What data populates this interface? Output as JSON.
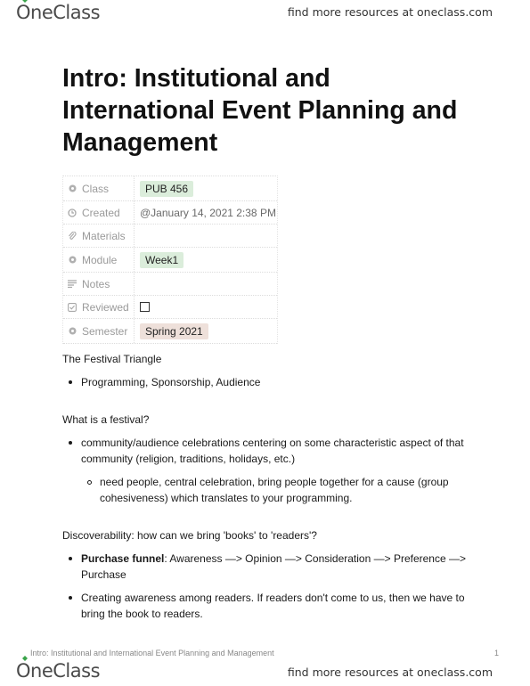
{
  "header": {
    "brand": "OneClass",
    "promo": "find more resources at oneclass.com"
  },
  "document": {
    "title": "Intro: Institutional and International Event Planning and Management",
    "properties": [
      {
        "key": "Class",
        "icon": "tag-icon",
        "value": "PUB 456",
        "type": "tag",
        "color": "#dbeddb"
      },
      {
        "key": "Created",
        "icon": "clock-icon",
        "value": "@January 14, 2021 2:38 PM",
        "type": "text"
      },
      {
        "key": "Materials",
        "icon": "paperclip-icon",
        "value": "",
        "type": "text"
      },
      {
        "key": "Module",
        "icon": "tag-icon",
        "value": "Week1",
        "type": "tag",
        "color": "#dbeddb"
      },
      {
        "key": "Notes",
        "icon": "text-lines-icon",
        "value": "",
        "type": "text"
      },
      {
        "key": "Reviewed",
        "icon": "checkbox-icon",
        "value": false,
        "type": "checkbox"
      },
      {
        "key": "Semester",
        "icon": "tag-icon",
        "value": "Spring 2021",
        "type": "tag",
        "color": "#eee0da"
      }
    ],
    "sections": {
      "festival_triangle": {
        "heading": "The Festival Triangle",
        "bullets": [
          "Programming, Sponsorship, Audience"
        ]
      },
      "what_is_festival": {
        "heading": "What is a festival?",
        "bullet": "community/audience celebrations centering on some characteristic aspect of that community (religion, traditions, holidays, etc.)",
        "sub_bullet": "need people, central celebration, bring people together for a cause (group cohesiveness) which translates to your programming."
      },
      "discoverability": {
        "heading": "Discoverability: how can we bring 'books' to 'readers'?",
        "funnel_label": "Purchase funnel",
        "funnel_text": ": Awareness —> Opinion —> Consideration —> Preference —> Purchase",
        "bullet2": "Creating awareness among readers. If readers don't come to us, then we have to bring the book to readers."
      }
    }
  },
  "footer": {
    "doc_title": "Intro: Institutional and International Event Planning and Management",
    "page_number": "1",
    "brand": "OneClass",
    "promo": "find more resources at oneclass.com"
  }
}
